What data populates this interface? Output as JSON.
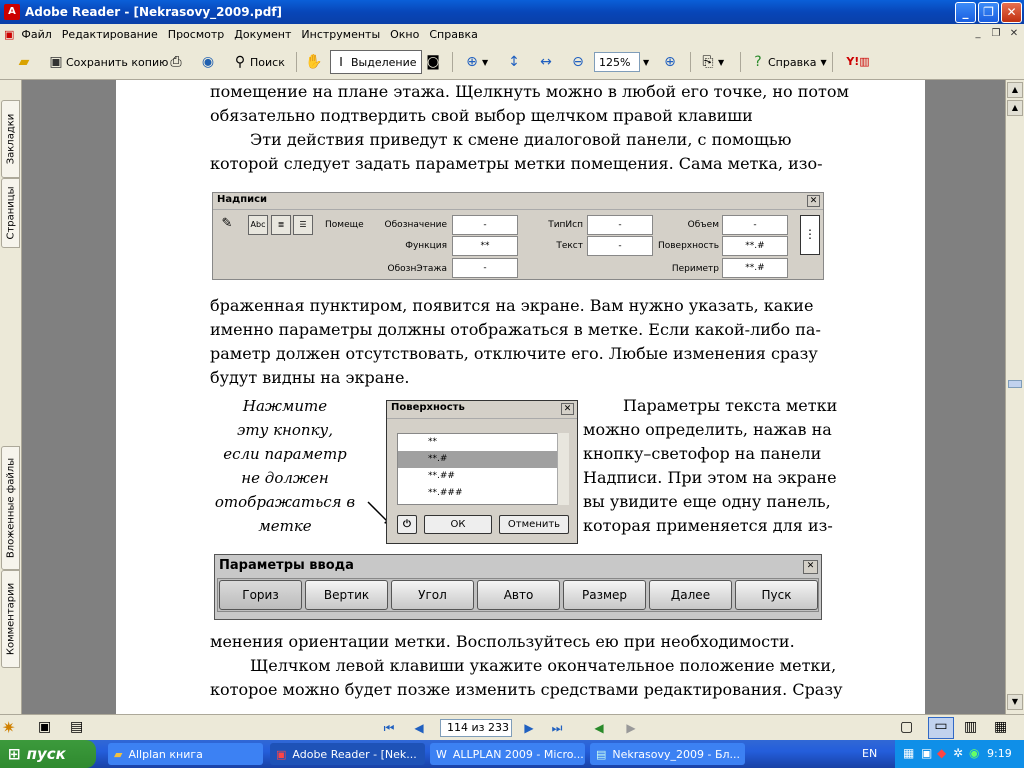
{
  "window": {
    "title": "Adobe Reader - [Nekrasovy_2009.pdf]"
  },
  "menu": [
    "Файл",
    "Редактирование",
    "Просмотр",
    "Документ",
    "Инструменты",
    "Окно",
    "Справка"
  ],
  "toolbar": {
    "save_copy": "Сохранить копию",
    "search": "Поиск",
    "select": "Выделение",
    "zoom": "125%",
    "help": "Справка"
  },
  "sidebar": {
    "bookmarks": "Закладки",
    "pages": "Страницы",
    "attachments": "Вложенные файлы",
    "comments": "Комментарии"
  },
  "doc": {
    "lines_top": [
      "помещение на плане этажа. Щелкнуть можно в любой его точке, но потом",
      "обязательно подтвердить свой выбор щелчком правой клавиши",
      "Эти действия приведут к смене диалоговой панели, с помощью",
      "которой следует задать параметры метки помещения. Сама метка, изо-"
    ],
    "lines_mid": [
      "браженная пунктиром, появится на экране.  Вам нужно указать, какие",
      "именно параметры должны  отображаться в метке. Если какой-либо па-",
      "раметр должен отсутствовать, отключите его.  Любые изменения сразу",
      "будут видны на экране."
    ],
    "note": [
      "Нажмите",
      "эту кнопку,",
      "если параметр",
      "не должен",
      "отображаться в",
      "метке"
    ],
    "right": [
      "Параметры текста метки",
      "можно определить, нажав на",
      "кнопку–светофор на панели",
      "Надписи. При этом на экране",
      "вы увидите еще одну панель,",
      "которая применяется для из-"
    ],
    "lines_bottom": [
      "менения ориентации метки. Воспользуйтесь ею при необходимости.",
      "Щелчком левой клавиши укажите окончательное положение метки,",
      "которое можно будет позже изменить средствами редактирования. Сразу"
    ]
  },
  "nadpisi": {
    "title": "Надписи",
    "tag": "Помеще",
    "labels": [
      "Обозначение",
      "Функция",
      "ОбознЭтажа",
      "ТипИсп",
      "Текст",
      "Объем",
      "Поверхность",
      "Периметр"
    ],
    "values": [
      "-",
      "**",
      "-",
      "-",
      "-",
      "-",
      "**.#",
      "**.#"
    ]
  },
  "surface": {
    "title": "Поверхность",
    "items": [
      "**",
      "**.#",
      "**.##",
      "**.###"
    ],
    "ok": "ОК",
    "cancel": "Отменить"
  },
  "params": {
    "title": "Параметры ввода",
    "buttons": [
      "Гориз",
      "Вертик",
      "Угол",
      "Авто",
      "Размер",
      "Далее",
      "Пуск"
    ]
  },
  "status": {
    "page": "114 из 233"
  },
  "taskbar": {
    "start": "пуск",
    "tasks": [
      "Allplan книга",
      "Adobe Reader - [Nek...",
      "ALLPLAN 2009 - Micro...",
      "Nekrasovy_2009 - Бл..."
    ],
    "lang": "EN",
    "time": "9:19"
  }
}
